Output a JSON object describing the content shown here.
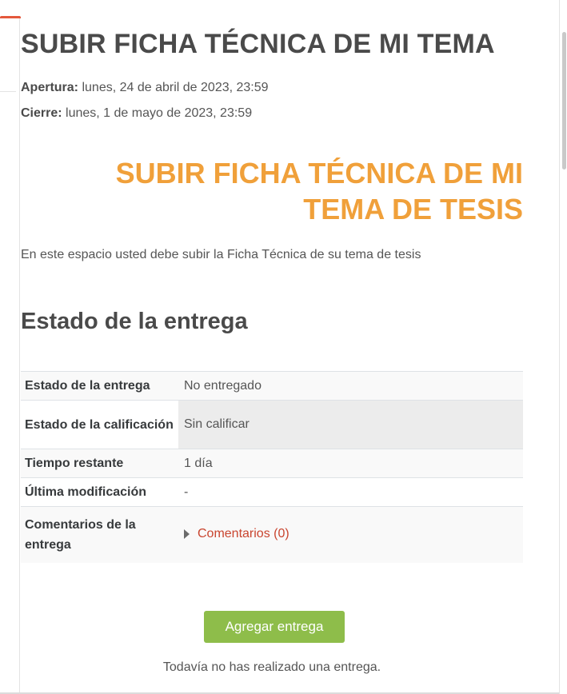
{
  "page": {
    "title": "SUBIR FICHA TÉCNICA DE MI TEMA"
  },
  "dates": {
    "open_label": "Apertura:",
    "open_value": "lunes, 24 de abril de 2023, 23:59",
    "close_label": "Cierre:",
    "close_value": "lunes, 1 de mayo de 2023, 23:59"
  },
  "description": {
    "heading_line1": "SUBIR FICHA TÉCNICA DE MI",
    "heading_line2": "TEMA DE TESIS",
    "text": "En este espacio usted debe subir la Ficha Técnica de su tema de tesis",
    "heading_color": "#f0a03a"
  },
  "submission_status": {
    "title": "Estado de la entrega",
    "rows": [
      {
        "label": "Estado de la entrega",
        "value": "No entregado"
      },
      {
        "label": "Estado de la calificación",
        "value": "Sin calificar"
      },
      {
        "label": "Tiempo restante",
        "value": "1 día"
      },
      {
        "label": "Última modificación",
        "value": "-"
      },
      {
        "label": "Comentarios de la entrega",
        "value": "Comentarios (0)"
      }
    ]
  },
  "actions": {
    "add_submission_label": "Agregar entrega",
    "add_submission_color": "#8ebd4a",
    "no_submission_text": "Todavía no has realizado una entrega."
  },
  "icons": {
    "comments_toggle": "caret-right-icon"
  }
}
